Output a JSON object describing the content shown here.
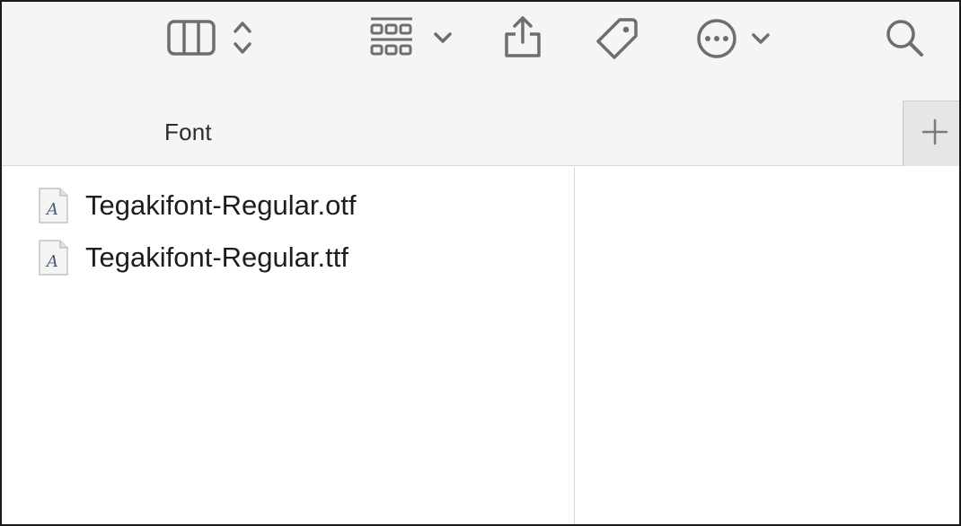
{
  "toolbar": {
    "buttons": [
      {
        "id": "view",
        "icon": "column-view-icon",
        "secondary_icon": "up-down-chevron-icon"
      },
      {
        "id": "group",
        "icon": "grid-group-icon",
        "secondary_icon": "chevron-down-icon"
      },
      {
        "id": "share",
        "icon": "share-icon"
      },
      {
        "id": "tags",
        "icon": "tag-icon"
      },
      {
        "id": "actions",
        "icon": "ellipsis-circle-icon",
        "secondary_icon": "chevron-down-icon"
      },
      {
        "id": "search",
        "icon": "search-icon"
      }
    ],
    "icon_color": "#6e6e6e"
  },
  "tabs": {
    "current": "Font",
    "add_label": "+"
  },
  "files": [
    {
      "name": "Tegakifont-Regular.otf",
      "icon": "font-file-icon"
    },
    {
      "name": "Tegakifont-Regular.ttf",
      "icon": "font-file-icon"
    }
  ]
}
